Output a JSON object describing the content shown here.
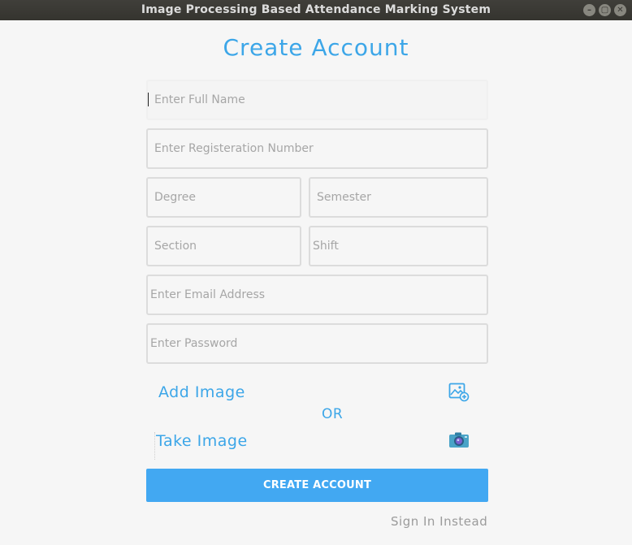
{
  "window": {
    "title": "Image Processing Based Attendance Marking System",
    "controls": {
      "minimize": "–",
      "maximize": "▢",
      "close": "✕"
    }
  },
  "form": {
    "heading": "Create Account",
    "full_name_placeholder": "Enter Full Name",
    "registration_placeholder": "Enter Registeration Number",
    "degree_placeholder": "Degree",
    "semester_placeholder": "Semester",
    "section_placeholder": "Section",
    "shift_placeholder": "Shift",
    "email_placeholder": "Enter Email Address",
    "password_placeholder": "Enter Password",
    "add_image_label": "Add Image",
    "or_label": "OR",
    "take_image_label": "Take Image",
    "create_button_label": "CREATE ACCOUNT",
    "sign_in_label": "Sign In Instead"
  },
  "icons": {
    "add_image": "image-add-icon",
    "take_image": "camera-icon"
  },
  "colors": {
    "accent": "#3ca6e8",
    "button": "#42a8f2",
    "titlebar": "#3b3a36",
    "background": "#f6f6f6"
  }
}
